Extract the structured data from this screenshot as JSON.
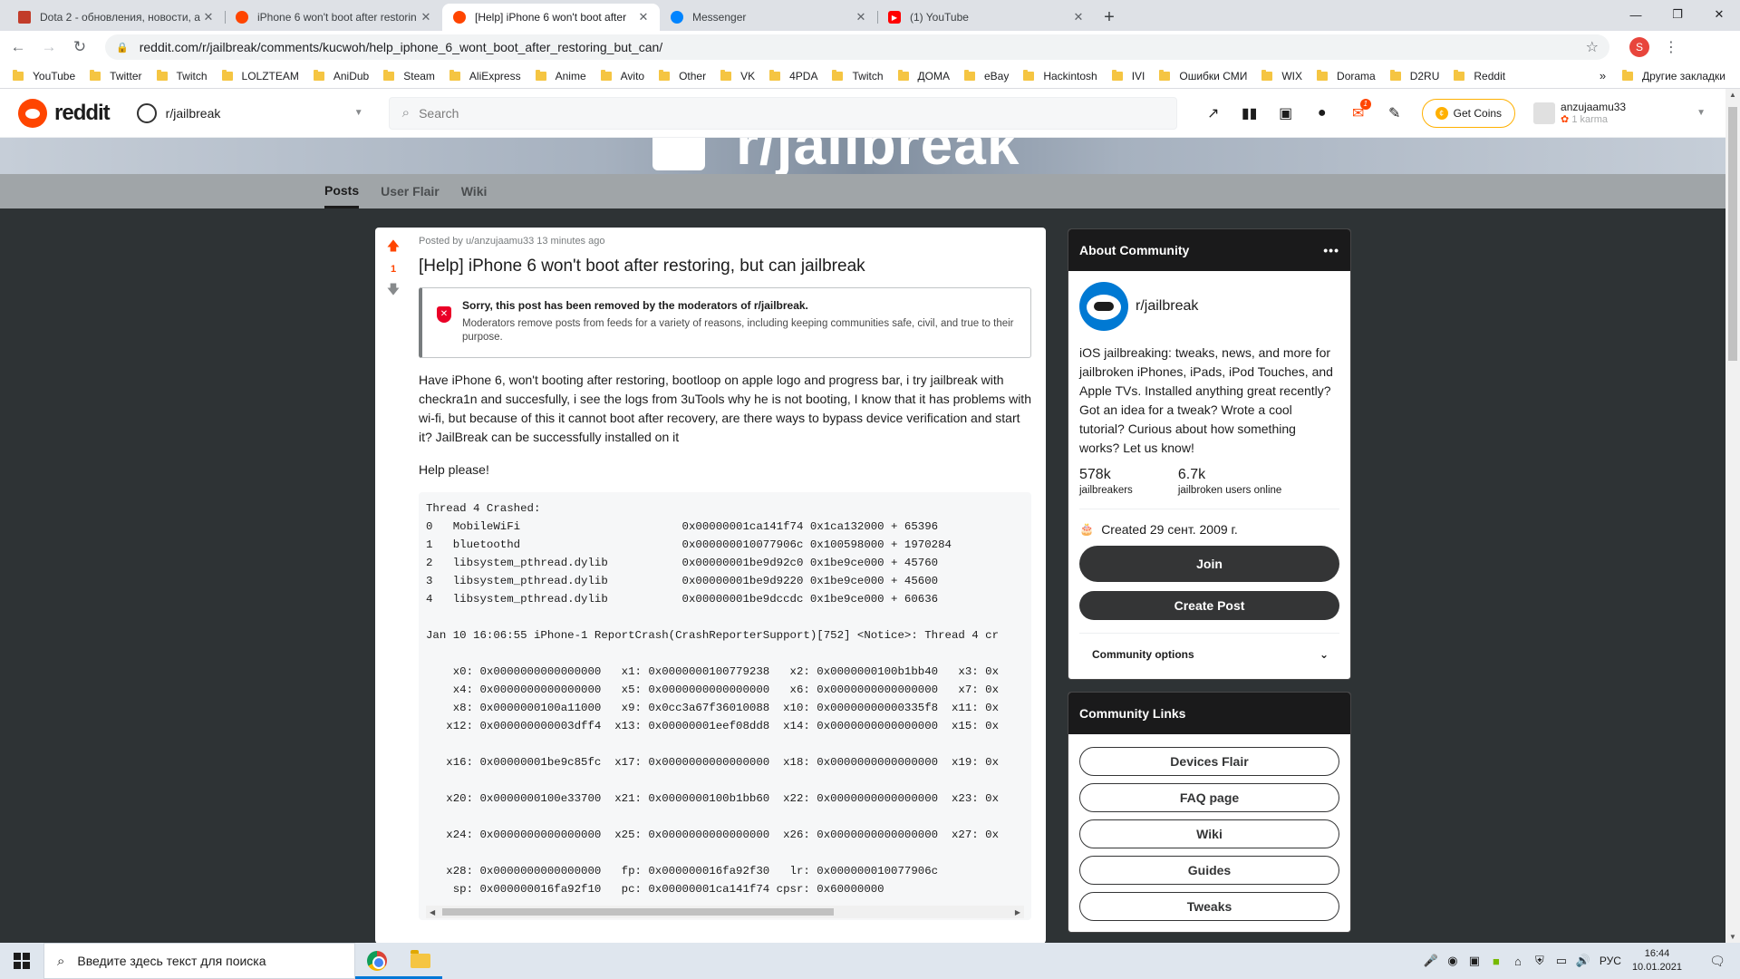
{
  "browser": {
    "tabs": [
      {
        "title": "Dota 2 - обновления, новости, а",
        "favicon_color": "#c23c2a",
        "active": false
      },
      {
        "title": "iPhone 6 won't boot after restorin",
        "favicon_color": "#ff4500",
        "active": false
      },
      {
        "title": "[Help] iPhone 6 won't boot after",
        "favicon_color": "#ff4500",
        "active": true
      },
      {
        "title": "Messenger",
        "favicon_color": "#0084ff",
        "active": false
      },
      {
        "title": "(1) YouTube",
        "favicon_color": "#ff0000",
        "active": false
      }
    ],
    "tab_close": "✕",
    "new_tab": "+",
    "window_controls": {
      "minimize": "—",
      "maximize": "❐",
      "close": "✕"
    },
    "url": "reddit.com/r/jailbreak/comments/kucwoh/help_iphone_6_wont_boot_after_restoring_but_can/",
    "profile_initial": "S",
    "bookmarks": [
      "YouTube",
      "Twitter",
      "Twitch",
      "LOLZTEAM",
      "AniDub",
      "Steam",
      "AliExpress",
      "Anime",
      "Avito",
      "Other",
      "VK",
      "4PDA",
      "Twitch",
      "ДОМА",
      "eBay",
      "Hackintosh",
      "IVI",
      "Ошибки СМИ",
      "WIX",
      "Dorama",
      "D2RU",
      "Reddit"
    ],
    "bookmarks_more": "»",
    "other_bookmarks": "Другие закладки"
  },
  "reddit_header": {
    "logo_text": "reddit",
    "subreddit": "r/jailbreak",
    "search_placeholder": "Search",
    "notification_count": "1",
    "get_coins": "Get Coins",
    "username": "anzujaamu33",
    "karma": "1 karma"
  },
  "banner": {
    "text": "r/jailbreak"
  },
  "subnav": {
    "tabs": [
      "Posts",
      "User Flair",
      "Wiki"
    ],
    "active": "Posts"
  },
  "post": {
    "votes": "1",
    "meta": "Posted by u/anzujaamu33 13 minutes ago",
    "title": "[Help] iPhone 6 won't boot after restoring, but can jailbreak",
    "removed_title": "Sorry, this post has been removed by the moderators of r/jailbreak.",
    "removed_text": "Moderators remove posts from feeds for a variety of reasons, including keeping communities safe, civil, and true to their purpose.",
    "body": "Have iPhone 6, won't booting after restoring, bootloop on apple logo and progress bar, i try jailbreak with checkra1n and succesfully, i see the logs from 3uTools why he is not booting, I know that it has problems with wi-fi, but because of this it cannot boot after recovery, are there ways to bypass device verification and start it? JailBreak can be successfully installed on it",
    "help": "Help please!",
    "code": "Thread 4 Crashed:\n0   MobileWiFi                        0x00000001ca141f74 0x1ca132000 + 65396\n1   bluetoothd                        0x000000010077906c 0x100598000 + 1970284\n2   libsystem_pthread.dylib           0x00000001be9d92c0 0x1be9ce000 + 45760\n3   libsystem_pthread.dylib           0x00000001be9d9220 0x1be9ce000 + 45600\n4   libsystem_pthread.dylib           0x00000001be9dccdc 0x1be9ce000 + 60636\n\nJan 10 16:06:55 iPhone-1 ReportCrash(CrashReporterSupport)[752] <Notice>: Thread 4 cr\n\n    x0: 0x0000000000000000   x1: 0x0000000100779238   x2: 0x0000000100b1bb40   x3: 0x\n    x4: 0x0000000000000000   x5: 0x0000000000000000   x6: 0x0000000000000000   x7: 0x\n    x8: 0x0000000100a11000   x9: 0x0cc3a67f36010088  x10: 0x00000000000335f8  x11: 0x\n   x12: 0x000000000003dff4  x13: 0x00000001eef08dd8  x14: 0x0000000000000000  x15: 0x\n\n   x16: 0x00000001be9c85fc  x17: 0x0000000000000000  x18: 0x0000000000000000  x19: 0x\n\n   x20: 0x0000000100e33700  x21: 0x0000000100b1bb60  x22: 0x0000000000000000  x23: 0x\n\n   x24: 0x0000000000000000  x25: 0x0000000000000000  x26: 0x0000000000000000  x27: 0x\n\n   x28: 0x0000000000000000   fp: 0x000000016fa92f30   lr: 0x000000010077906c\n    sp: 0x000000016fa92f10   pc: 0x00000001ca141f74 cpsr: 0x60000000"
  },
  "sidebar": {
    "about_title": "About Community",
    "community_name": "r/jailbreak",
    "description": "iOS jailbreaking: tweaks, news, and more for jailbroken iPhones, iPads, iPod Touches, and Apple TVs. Installed anything great recently? Got an idea for a tweak? Wrote a cool tutorial? Curious about how something works? Let us know!",
    "members_value": "578k",
    "members_label": "jailbreakers",
    "online_value": "6.7k",
    "online_label": "jailbroken users online",
    "created": "Created 29 сент. 2009 г.",
    "join": "Join",
    "create_post": "Create Post",
    "community_options": "Community options",
    "links_title": "Community Links",
    "links": [
      "Devices Flair",
      "FAQ page",
      "Wiki",
      "Guides",
      "Tweaks"
    ]
  },
  "taskbar": {
    "search_placeholder": "Введите здесь текст для поиска",
    "lang": "РУС",
    "time": "16:44",
    "date": "10.01.2021"
  }
}
